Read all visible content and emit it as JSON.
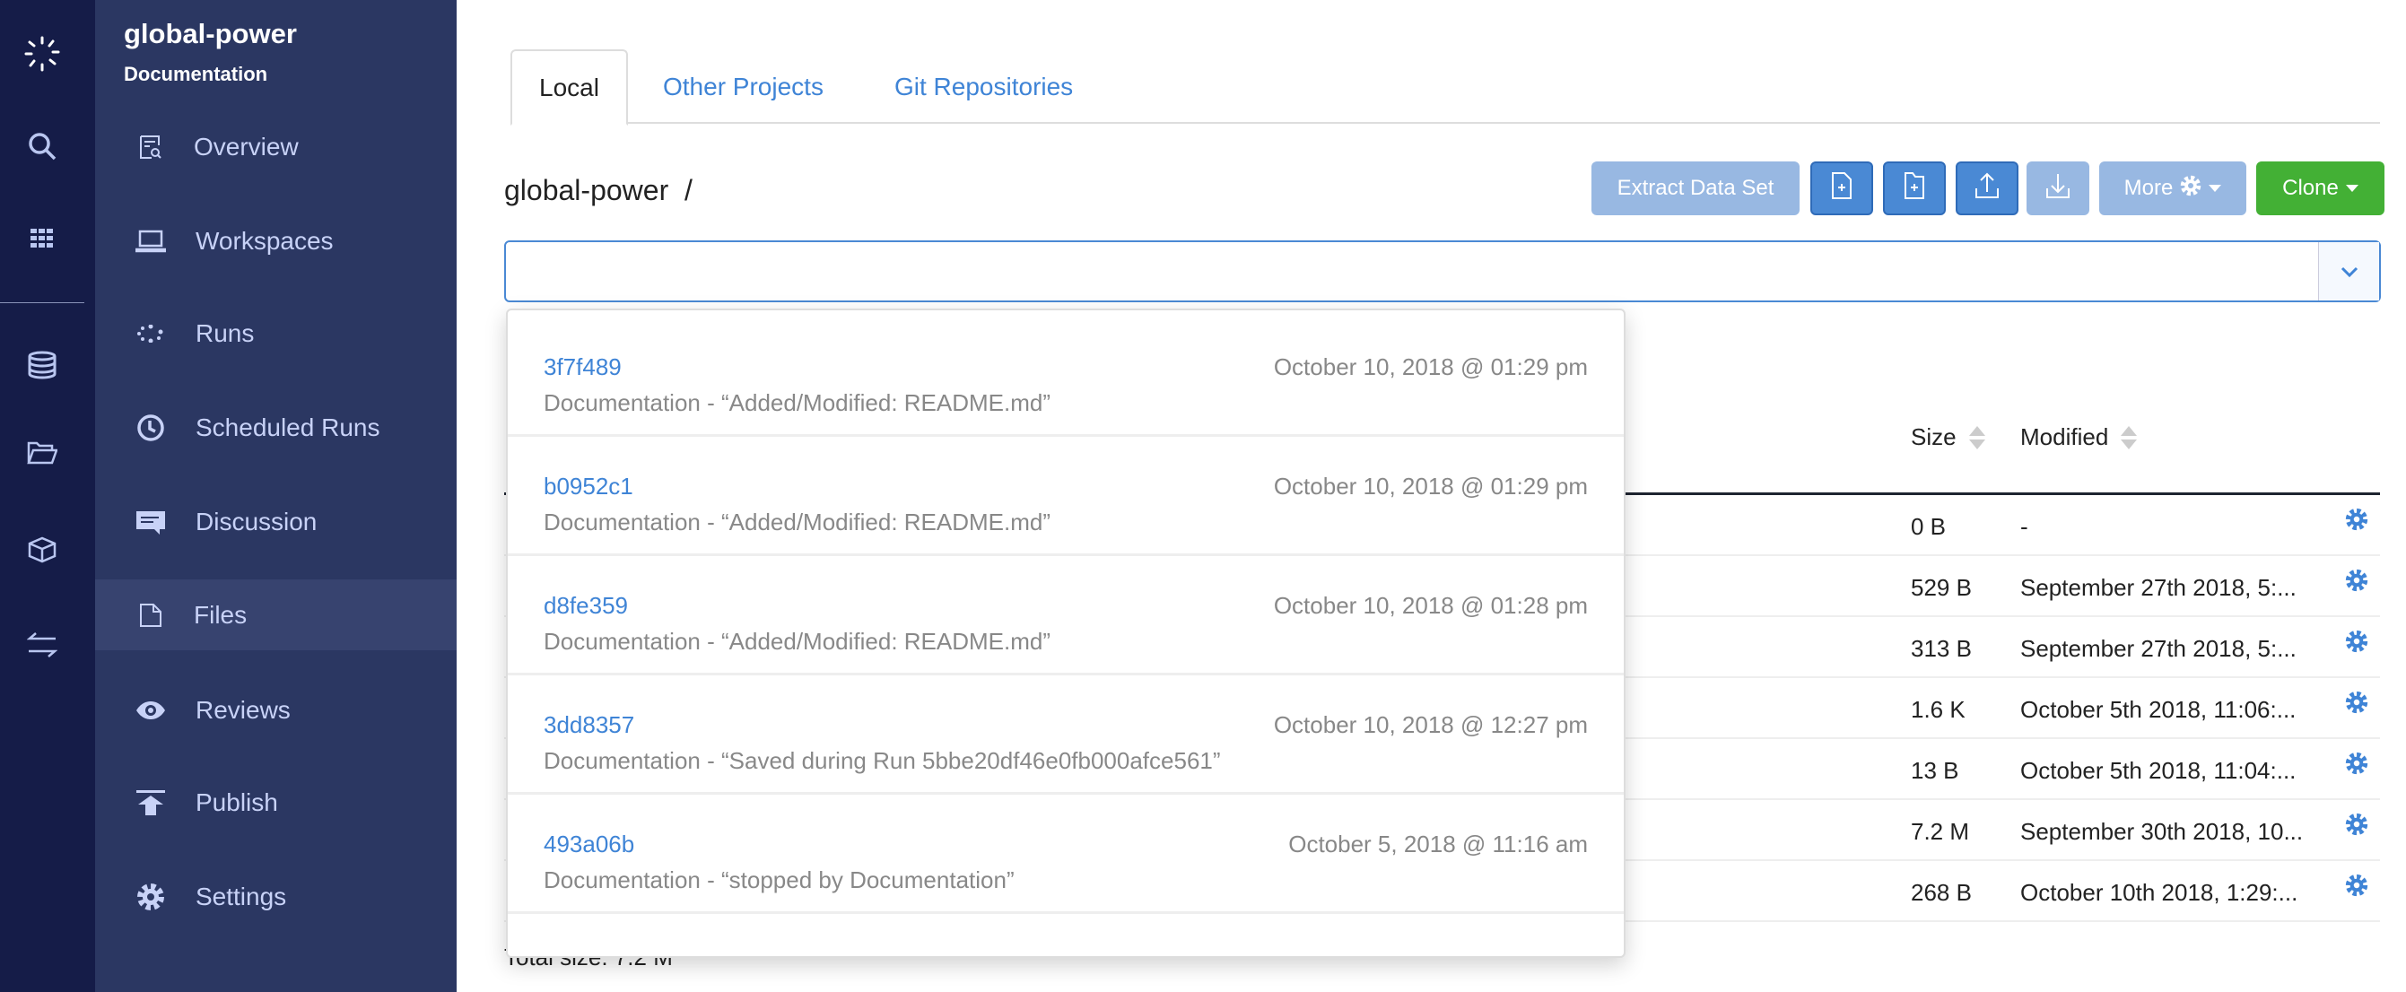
{
  "rail": {
    "icons": [
      "logo-icon",
      "search-icon",
      "apps-grid-icon",
      "database-icon",
      "folder-icon",
      "cube-icon",
      "transfer-arrows-icon"
    ]
  },
  "sidebar": {
    "project": "global-power",
    "owner": "Documentation",
    "items": [
      {
        "label": "Overview",
        "icon": "overview-icon"
      },
      {
        "label": "Workspaces",
        "icon": "laptop-icon"
      },
      {
        "label": "Runs",
        "icon": "runs-spinner-icon"
      },
      {
        "label": "Scheduled Runs",
        "icon": "clock-icon"
      },
      {
        "label": "Discussion",
        "icon": "chat-icon"
      },
      {
        "label": "Files",
        "icon": "file-icon",
        "active": true
      },
      {
        "label": "Reviews",
        "icon": "eye-icon"
      },
      {
        "label": "Publish",
        "icon": "publish-icon"
      },
      {
        "label": "Settings",
        "icon": "gear-icon"
      }
    ]
  },
  "tabs": [
    {
      "label": "Local",
      "active": true
    },
    {
      "label": "Other Projects"
    },
    {
      "label": "Git Repositories"
    }
  ],
  "breadcrumb": "global-power  /",
  "toolbar": {
    "extract": "Extract Data Set",
    "more": "More",
    "clone": "Clone",
    "icons": [
      "new-file-icon",
      "new-folder-icon",
      "upload-icon",
      "download-icon"
    ]
  },
  "search": {
    "value": "",
    "placeholder": ""
  },
  "table": {
    "headers": {
      "size": "Size",
      "modified": "Modified"
    },
    "rows": [
      {
        "size": "0 B",
        "modified": "-"
      },
      {
        "size": "529 B",
        "modified": "September 27th 2018, 5:..."
      },
      {
        "size": "313 B",
        "modified": "September 27th 2018, 5:..."
      },
      {
        "size": "1.6 K",
        "modified": "October 5th 2018, 11:06:..."
      },
      {
        "size": "13 B",
        "modified": "October 5th 2018, 11:04:..."
      },
      {
        "size": "7.2 M",
        "modified": "September 30th 2018, 10..."
      },
      {
        "size": "268 B",
        "modified": "October 10th 2018, 1:29:..."
      }
    ],
    "total": "Total size: 7.2 M"
  },
  "commits": [
    {
      "hash": "3f7f489",
      "date": "October 10, 2018 @ 01:29 pm",
      "desc": "Documentation - “Added/Modified: README.md”"
    },
    {
      "hash": "b0952c1",
      "date": "October 10, 2018 @ 01:29 pm",
      "desc": "Documentation - “Added/Modified: README.md”"
    },
    {
      "hash": "d8fe359",
      "date": "October 10, 2018 @ 01:28 pm",
      "desc": "Documentation - “Added/Modified: README.md”"
    },
    {
      "hash": "3dd8357",
      "date": "October 10, 2018 @ 12:27 pm",
      "desc": "Documentation - “Saved during Run 5bbe20df46e0fb000afce561”"
    },
    {
      "hash": "493a06b",
      "date": "October 5, 2018 @ 11:16 am",
      "desc": "Documentation - “stopped by Documentation”"
    }
  ],
  "colors": {
    "rail": "#151c48",
    "sidebar": "#2b3762",
    "link": "#3f84d6",
    "primary": "#4a89d4",
    "success": "#43b035"
  }
}
